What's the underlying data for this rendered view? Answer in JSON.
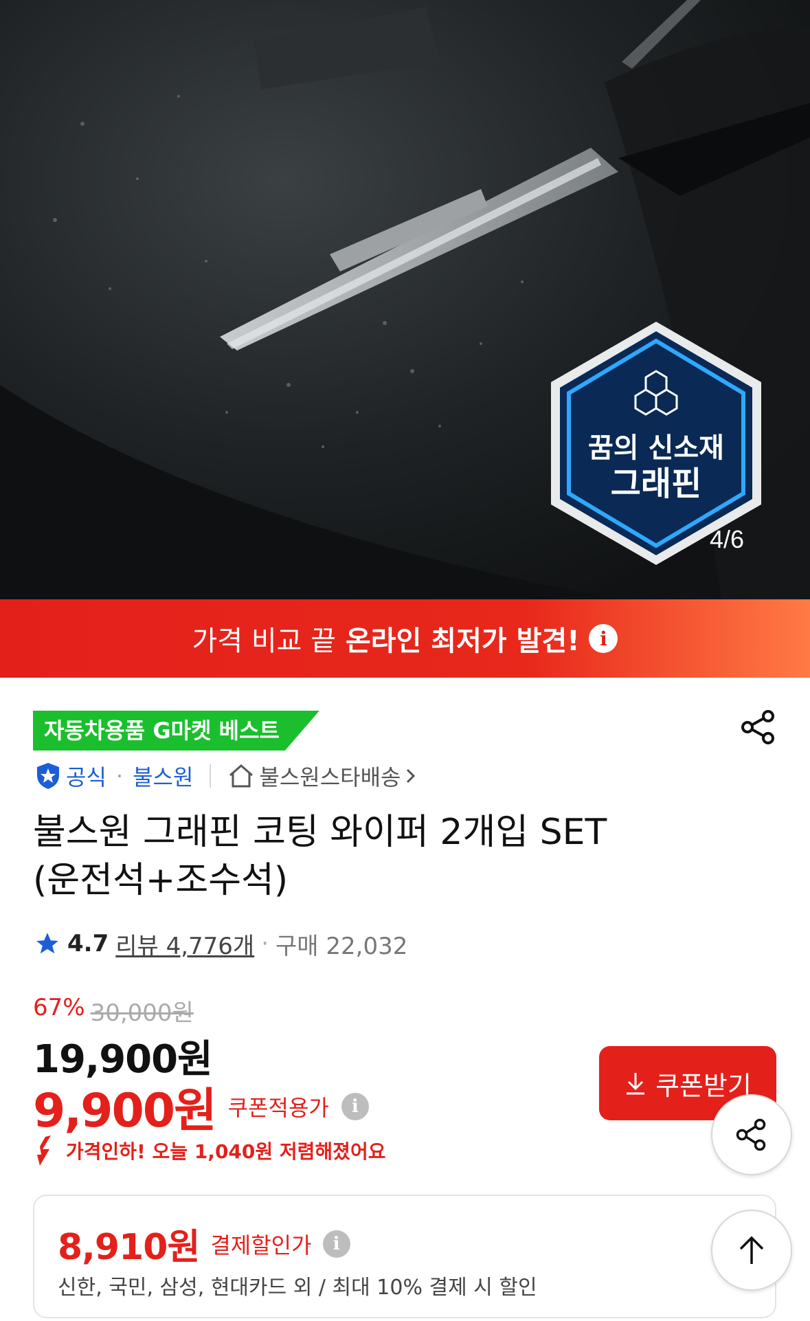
{
  "hero": {
    "badge_line1": "꿈의 신소재",
    "badge_line2": "그래핀",
    "page_counter": "4/6"
  },
  "promo": {
    "normal_text": "가격 비교 끝",
    "strong_text": "온라인 최저가 발견!",
    "info_icon": "i"
  },
  "product": {
    "best_badge": "자동차용품 G마켓 베스트",
    "official_label": "공식",
    "brand": "불스원",
    "store_name": "불스원스타배송",
    "title_line1": "불스원 그래핀 코팅 와이퍼 2개입 SET",
    "title_line2": "(운전석+조수석)",
    "rating": "4.7",
    "review_text": "리뷰 4,776개",
    "purchase_text": "구매 22,032"
  },
  "price": {
    "discount_rate": "67%",
    "original_price": "30,000원",
    "sale_price": "19,900원",
    "coupon_price": "9,900원",
    "coupon_label": "쿠폰적용가",
    "coupon_button": "쿠폰받기",
    "price_drop_text": "가격인하! 오늘 1,040원 저렴해졌어요"
  },
  "payment": {
    "price": "8,910원",
    "label": "결제할인가",
    "description": "신한, 국민, 삼성, 현대카드 외 / 최대 10% 결제 시 할인"
  },
  "icons": {
    "share": "share-icon",
    "top": "arrow-up-icon",
    "star": "star-icon",
    "shield": "shield-check-icon",
    "home": "home-icon",
    "download": "download-icon"
  },
  "colors": {
    "accent_red": "#e4201b",
    "best_green": "#1bbf2d",
    "official_blue": "#1a5fd6"
  }
}
